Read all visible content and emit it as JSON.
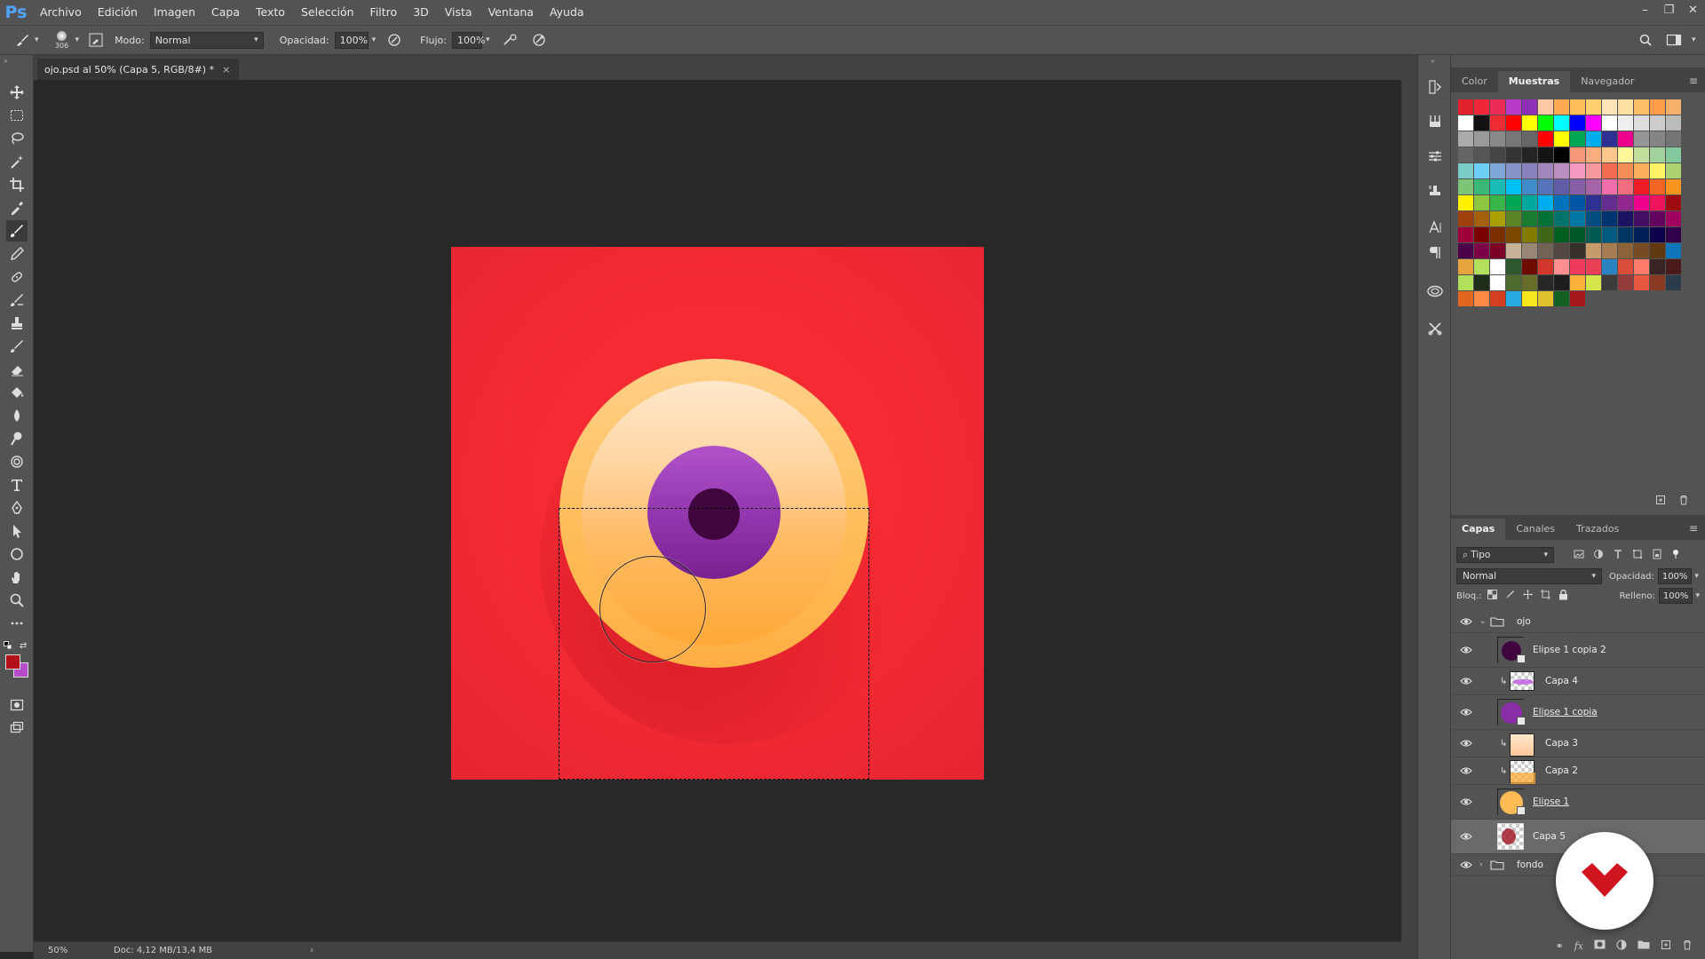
{
  "app": {
    "logo": "Ps"
  },
  "menu": [
    "Archivo",
    "Edición",
    "Imagen",
    "Capa",
    "Texto",
    "Selección",
    "Filtro",
    "3D",
    "Vista",
    "Ventana",
    "Ayuda"
  ],
  "window_controls": [
    "–",
    "❐",
    "✕"
  ],
  "options": {
    "brush_size": "306",
    "mode_label": "Modo:",
    "mode_value": "Normal",
    "opacity_label": "Opacidad:",
    "opacity_value": "100%",
    "flow_label": "Flujo:",
    "flow_value": "100%"
  },
  "document": {
    "tab_title": "ojo.psd al 50% (Capa 5, RGB/8#) *",
    "close": "×"
  },
  "status": {
    "zoom": "50%",
    "doc_size": "Doc: 4,12 MB/13,4 MB",
    "arrow": "›"
  },
  "swatches_panel": {
    "tabs": [
      "Color",
      "Muestras",
      "Navegador"
    ],
    "active_tab": "Muestras",
    "colors": [
      "#e2222a",
      "#f0263a",
      "#e92b55",
      "#b83ac9",
      "#8e2fb5",
      "#ffc9a8",
      "#ffab53",
      "#ffbe5c",
      "#ffd06d",
      "#ffe5b9",
      "#ffe0a3",
      "#ffc168",
      "#ff9d4a",
      "#f7b06a",
      "#ffffff",
      "#111111",
      "#ec2b33",
      "#ff0000",
      "#ffff00",
      "#00ff00",
      "#00ffff",
      "#0000ff",
      "#ff00ff",
      "#ffffff",
      "#eeeeee",
      "#dddddd",
      "#cccccc",
      "#bbbbbb",
      "#aaaaaa",
      "#999999",
      "#888888",
      "#777777",
      "#666666",
      "#ff0000",
      "#ffff00",
      "#00a651",
      "#00aeef",
      "#2e3192",
      "#ec008c",
      "#959595",
      "#858585",
      "#757575",
      "#656565",
      "#555555",
      "#454545",
      "#343434",
      "#242424",
      "#141414",
      "#000000",
      "#f7977a",
      "#f9ad81",
      "#fdc68a",
      "#fff79a",
      "#c4df9b",
      "#a3d39c",
      "#82ca9d",
      "#7bcdc8",
      "#6ecff6",
      "#7ea7d8",
      "#8493ca",
      "#8882be",
      "#a187be",
      "#bc8dbf",
      "#f49ac2",
      "#f6989d",
      "#f26c4f",
      "#f68e55",
      "#fbaf5c",
      "#fff467",
      "#acd372",
      "#7cc576",
      "#3bb878",
      "#1abbb4",
      "#00bff3",
      "#438ccb",
      "#5574b9",
      "#605ca8",
      "#855fa8",
      "#a763a8",
      "#f06ea9",
      "#f26d7d",
      "#ed1c24",
      "#f26522",
      "#f7941d",
      "#fff200",
      "#8dc73f",
      "#39b54a",
      "#00a651",
      "#00a99d",
      "#00aeef",
      "#0072bc",
      "#0054a6",
      "#2e3192",
      "#662d91",
      "#92278f",
      "#ec008c",
      "#ed145b",
      "#9e0b0f",
      "#a0410d",
      "#a36209",
      "#aba000",
      "#598527",
      "#197b30",
      "#007236",
      "#00746b",
      "#0076a3",
      "#004b80",
      "#003471",
      "#1b1464",
      "#440e62",
      "#630460",
      "#9e005d",
      "#9e0039",
      "#790000",
      "#7b2e00",
      "#7d4900",
      "#827b00",
      "#406618",
      "#005e20",
      "#005826",
      "#005952",
      "#005b7f",
      "#003663",
      "#002157",
      "#0d004c",
      "#32004b",
      "#4b0049",
      "#7b0046",
      "#7a0026",
      "#c7b299",
      "#998675",
      "#736357",
      "#534741",
      "#372f2a",
      "#c69c6d",
      "#a67c52",
      "#8c6239",
      "#754c24",
      "#603913",
      "#0f74b8",
      "#e5a43c",
      "#b3e05c",
      "#ffffff",
      "#2d572c",
      "#6e0b00",
      "#d1382b",
      "#ff8e8e",
      "#f03a5c",
      "#e94057",
      "#2a84c2",
      "#d94d3a",
      "#ff7c6a",
      "#3a2323",
      "#4b1a1a",
      "#b2e05c",
      "#1f2e1a",
      "#ffffff",
      "#4e6a2f",
      "#696d2a",
      "#272727",
      "#1d1d1d",
      "#fab03b",
      "#d4e64c",
      "#3b3b3b",
      "#943b3b",
      "#ea573f",
      "#8a3a22",
      "#2a3b4c",
      "#e2661f",
      "#fd8b47",
      "#d2401f",
      "#28aae1",
      "#f8e71c",
      "#e0c02d",
      "#145f24",
      "#a31919"
    ]
  },
  "layers_panel": {
    "tabs": [
      "Capas",
      "Canales",
      "Trazados"
    ],
    "active_tab": "Capas",
    "filter_value": "Tipo",
    "blend_mode": "Normal",
    "opacity_label": "Opacidad:",
    "opacity_value": "100%",
    "lock_label": "Bloq.:",
    "fill_label": "Relleno:",
    "fill_value": "100%",
    "layers": [
      {
        "name": "ojo",
        "kind": "group-open"
      },
      {
        "name": "Elipse 1 copia 2",
        "kind": "shape"
      },
      {
        "name": "Capa 4",
        "kind": "clipped"
      },
      {
        "name": "Elipse 1 copia",
        "kind": "shape"
      },
      {
        "name": "Capa 3",
        "kind": "clipped"
      },
      {
        "name": "Capa 2",
        "kind": "clipped"
      },
      {
        "name": "Elipse 1",
        "kind": "shape"
      },
      {
        "name": "Capa 5",
        "kind": "pixel",
        "selected": true
      },
      {
        "name": "fondo",
        "kind": "group-closed"
      }
    ],
    "footer_icons": [
      "link-icon",
      "fx-icon",
      "mask-icon",
      "adjustment-icon",
      "folder-icon",
      "new-layer-icon",
      "trash-icon"
    ]
  },
  "colors": {
    "foreground": "#b3111a",
    "background": "#b64bc9",
    "canvas_red": "#f52a33",
    "eye_yellow": "#ffbf5e",
    "iris_purple": "#9438b0",
    "pupil": "#40073f"
  }
}
